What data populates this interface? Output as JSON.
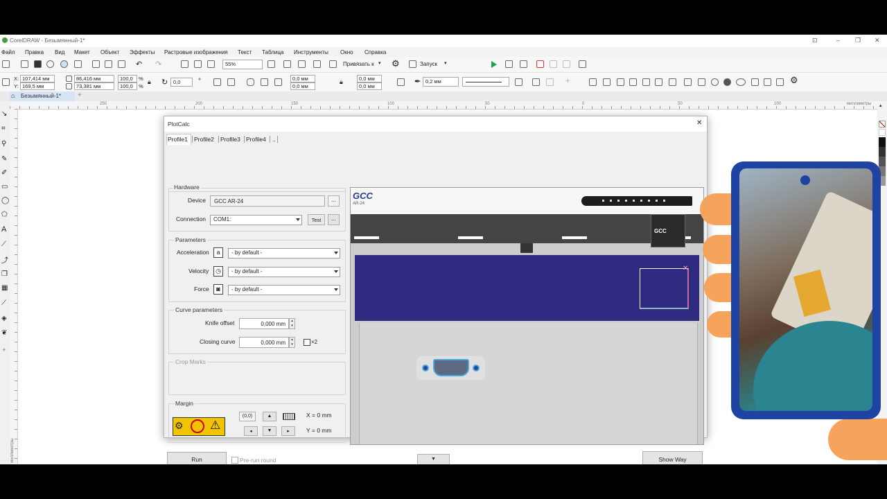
{
  "window": {
    "title": "CorelDRAW - Безымянный-1*",
    "minimize": "–",
    "restore": "❐",
    "close": "✕",
    "options": "⊡"
  },
  "menu": [
    "Файл",
    "Правка",
    "Вид",
    "Макет",
    "Объект",
    "Эффекты",
    "Растровые изображения",
    "Текст",
    "Таблица",
    "Инструменты",
    "Окно",
    "Справка"
  ],
  "toolbar": {
    "zoom": "55%",
    "snap_label": "Привязать к",
    "launch_label": "Запуск"
  },
  "properties": {
    "x": "107,414 мм",
    "y": "169,5 мм",
    "w": "86,416 мм",
    "h": "73,381 мм",
    "sx": "100,0",
    "sy": "100,0",
    "pct": "%",
    "rotation": "0,0",
    "deg": "°",
    "corner1": "0,0 мм",
    "corner2": "0,0 мм",
    "corner3": "0,0 мм",
    "corner4": "0,0 мм",
    "outline": "0,2 мм",
    "x_label": "X:",
    "y_label": "Y:"
  },
  "document_tab": "Безымянный-1*",
  "ruler": {
    "ticks": [
      "250",
      "200",
      "150",
      "100",
      "50",
      "0",
      "50",
      "100",
      "150",
      "200",
      "250",
      "300",
      "350",
      "400",
      "450"
    ],
    "unit": "миллиметры",
    "vunit": "миллиметры"
  },
  "dialog": {
    "title": "PlotCalc",
    "close": "✕",
    "tabs": [
      "Profile1",
      "Profile2",
      "Profile3",
      "Profile4",
      ".."
    ],
    "hardware": {
      "title": "Hardware",
      "device_label": "Device",
      "device_value": "GCC AR-24",
      "browse": "...",
      "connection_label": "Connection",
      "connection_value": "COM1:",
      "test_button": "Test",
      "more": "..."
    },
    "parameters": {
      "title": "Parameters",
      "acceleration_label": "Acceleration",
      "acceleration_value": "- by default -",
      "velocity_label": "Velocity",
      "velocity_value": "- by default -",
      "force_label": "Force",
      "force_value": "- by default -"
    },
    "curve": {
      "title": "Curve parameters",
      "knife_label": "Knife offset",
      "knife_value": "0,000 mm",
      "closing_label": "Closing curve",
      "closing_value": "0,000 mm",
      "x2_label": "×2"
    },
    "crop": {
      "title": "Crop Marks"
    },
    "margin": {
      "title": "Margin",
      "origin": "(0,0)",
      "x_readout": "X = 0 mm",
      "y_readout": "Y = 0 mm"
    },
    "run_button": "Run",
    "prerun_label": "Pre-run round",
    "show_way_button": "Show Way",
    "device_brand": "GCC",
    "device_model": "AR-24"
  },
  "colors": {
    "mat": "#2e2a80",
    "accent": "#1aa34a",
    "phone": "#1f43a2",
    "hand": "#f6a45c"
  }
}
